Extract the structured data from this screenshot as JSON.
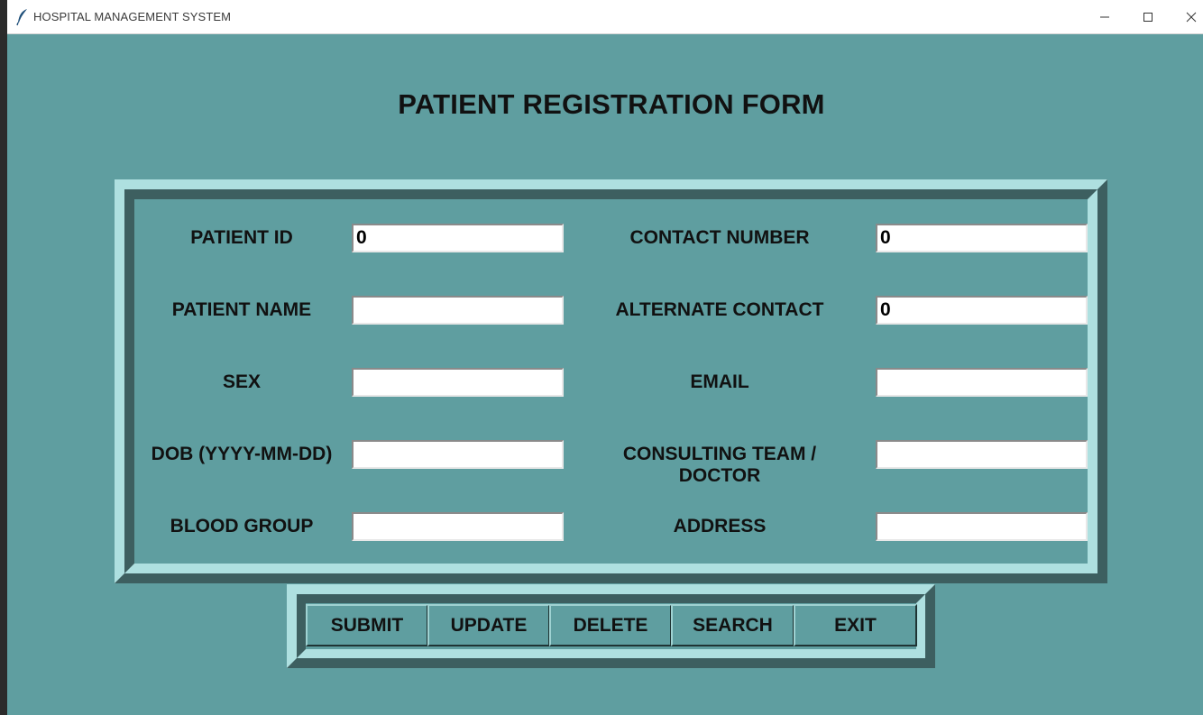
{
  "window": {
    "title": "HOSPITAL MANAGEMENT SYSTEM",
    "app_icon": "feather-icon",
    "controls": [
      "minimize-icon",
      "maximize-icon",
      "close-icon"
    ]
  },
  "form": {
    "title": "PATIENT REGISTRATION FORM",
    "left_fields": [
      {
        "label": "PATIENT ID",
        "value": "0"
      },
      {
        "label": "PATIENT NAME",
        "value": ""
      },
      {
        "label": "SEX",
        "value": ""
      },
      {
        "label": "DOB (YYYY-MM-DD)",
        "value": ""
      },
      {
        "label": "BLOOD GROUP",
        "value": ""
      }
    ],
    "right_fields": [
      {
        "label": "CONTACT NUMBER",
        "value": "0"
      },
      {
        "label": "ALTERNATE CONTACT",
        "value": "0"
      },
      {
        "label": "EMAIL",
        "value": ""
      },
      {
        "label": "CONSULTING TEAM / DOCTOR",
        "value": ""
      },
      {
        "label": "ADDRESS",
        "value": ""
      }
    ]
  },
  "buttons": {
    "submit": "SUBMIT",
    "update": "UPDATE",
    "delete": "DELETE",
    "search": "SEARCH",
    "exit": "EXIT"
  },
  "colors": {
    "background": "#5f9ea0",
    "frame_light": "#aee0e0",
    "frame_dark": "#3d5f60",
    "field": "#ffffff"
  }
}
